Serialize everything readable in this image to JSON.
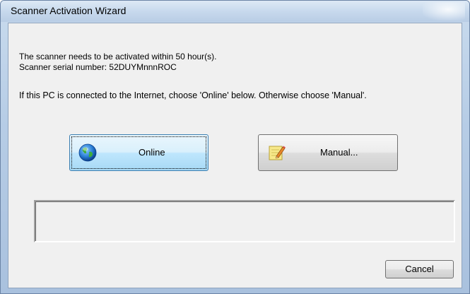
{
  "window": {
    "title": "Scanner Activation Wizard"
  },
  "message": {
    "line1": "The scanner needs to be activated within 50 hour(s).",
    "line2": "Scanner serial number: 52DUYMnnnROC",
    "instruction": "If this PC is connected to the Internet, choose 'Online' below. Otherwise choose 'Manual'."
  },
  "buttons": {
    "online": {
      "label": "Online",
      "icon": "globe-icon"
    },
    "manual": {
      "label": "Manual...",
      "icon": "notepad-pencil-icon"
    },
    "cancel": {
      "label": "Cancel"
    }
  },
  "status_box": {
    "text": ""
  },
  "colors": {
    "titlebar": "#c7d9ed",
    "client_bg": "#f0f0f0",
    "focus_button": "#bee6fd"
  }
}
